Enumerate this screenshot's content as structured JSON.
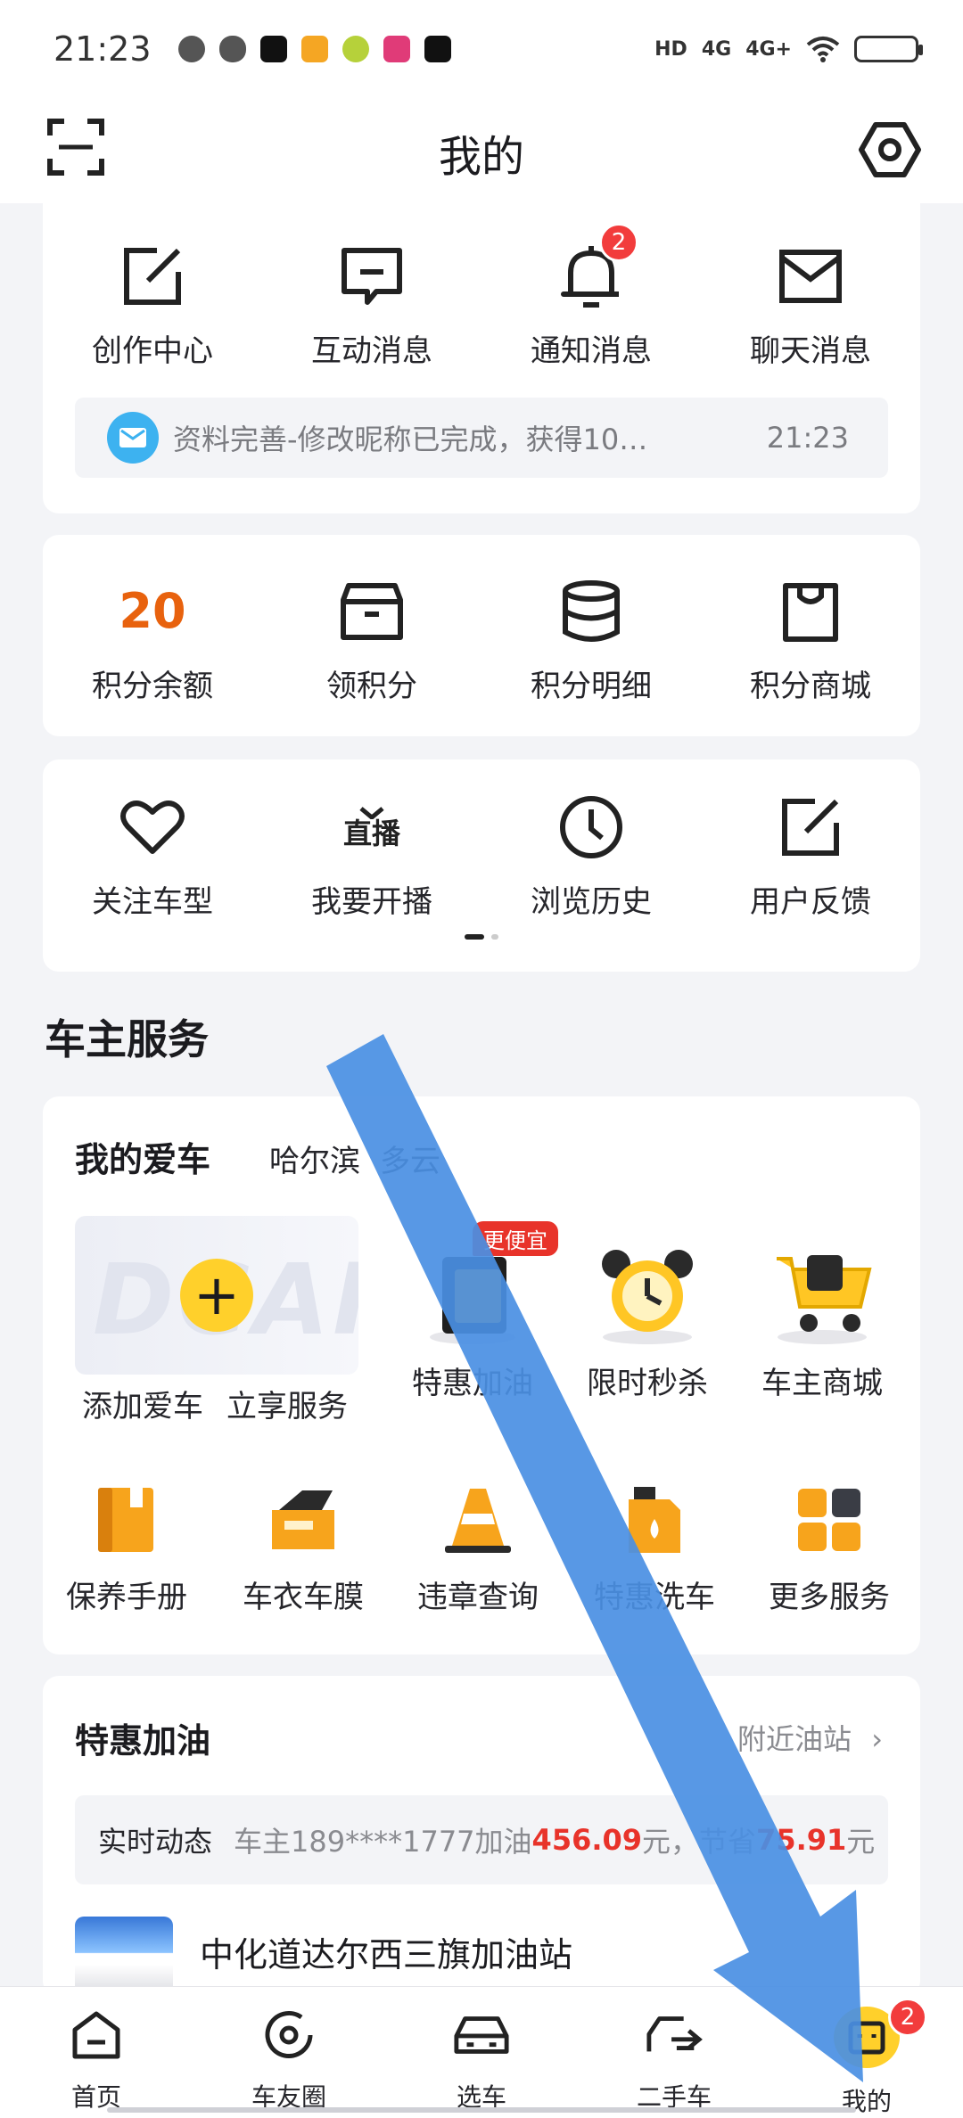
{
  "status_bar": {
    "time": "21:23",
    "network": [
      "HD",
      "4G",
      "4G+"
    ],
    "icons": [
      "wechat-icon",
      "cloud-icon",
      "tiktok-icon",
      "weibo-icon",
      "game-icon",
      "5g-app-icon",
      "capcut-icon",
      "wifi-icon",
      "battery-icon"
    ]
  },
  "header": {
    "title": "我的",
    "left_icon": "scan-icon",
    "right_icon": "settings-icon"
  },
  "messages": {
    "items": [
      {
        "label": "创作中心",
        "icon": "edit-icon"
      },
      {
        "label": "互动消息",
        "icon": "comment-icon"
      },
      {
        "label": "通知消息",
        "icon": "bell-icon",
        "badge": "2"
      },
      {
        "label": "聊天消息",
        "icon": "mail-icon"
      }
    ],
    "latest": {
      "text": "资料完善-修改昵称已完成，获得10…",
      "time": "21:23"
    }
  },
  "points": {
    "balance": "20",
    "items": [
      {
        "label": "积分余额"
      },
      {
        "label": "领积分",
        "icon": "box-icon"
      },
      {
        "label": "积分明细",
        "icon": "database-icon"
      },
      {
        "label": "积分商城",
        "icon": "bag-icon"
      }
    ]
  },
  "shortcuts": {
    "items": [
      {
        "label": "关注车型",
        "icon": "heart-icon"
      },
      {
        "label": "我要开播",
        "icon": "live-tv-icon",
        "glyph": "直播"
      },
      {
        "label": "浏览历史",
        "icon": "clock-icon"
      },
      {
        "label": "用户反馈",
        "icon": "edit-icon"
      }
    ],
    "page_index": 1,
    "page_count": 2
  },
  "owner_services": {
    "section_title": "车主服务",
    "tabs": [
      "我的爱车",
      "哈尔滨",
      "多云"
    ],
    "add_car": {
      "label": "添加爱车",
      "watermark": "DCAR"
    },
    "row1": [
      {
        "label": "立享服务"
      },
      {
        "label": "特惠加油",
        "tag": "更便宜",
        "icon": "fuel-card-icon"
      },
      {
        "label": "限时秒杀",
        "icon": "alarm-clock-icon"
      },
      {
        "label": "车主商城",
        "icon": "shopping-cart-icon"
      }
    ],
    "row2": [
      {
        "label": "保养手册",
        "icon": "manual-icon"
      },
      {
        "label": "车衣车膜",
        "icon": "film-icon"
      },
      {
        "label": "违章查询",
        "icon": "traffic-cone-icon"
      },
      {
        "label": "特惠洗车",
        "icon": "wash-liquid-icon"
      },
      {
        "label": "更多服务",
        "icon": "grid-icon"
      }
    ]
  },
  "fuel": {
    "title": "特惠加油",
    "nearby": "附近油站",
    "live_label": "实时动态",
    "live_prefix": "车主189****1777加油",
    "live_amount": "456.09",
    "live_mid": "元，节省",
    "live_saved": "75.91",
    "live_suffix": "元",
    "station_name": "中化道达尔西三旗加油站"
  },
  "tab_bar": {
    "items": [
      {
        "label": "首页",
        "icon": "home-icon"
      },
      {
        "label": "车友圈",
        "icon": "circle-icon"
      },
      {
        "label": "选车",
        "icon": "car-icon"
      },
      {
        "label": "二手车",
        "icon": "used-car-icon"
      },
      {
        "label": "我的",
        "icon": "profile-icon",
        "badge": "2"
      }
    ]
  },
  "colors": {
    "accent": "#ffd02b",
    "points": "#e8620e",
    "badge": "#f23c3c",
    "arrow": "#4a8fe3"
  }
}
